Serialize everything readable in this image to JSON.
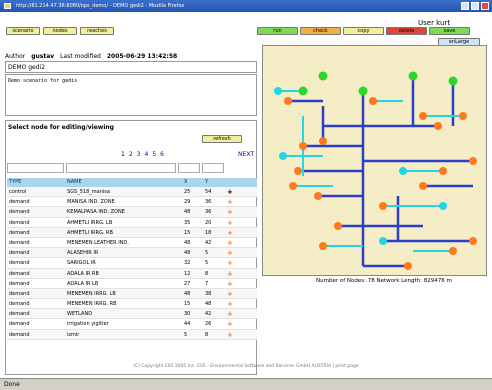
{
  "window": {
    "title": "http://81.214.47.36:8080/ops_demo/ - DEMO gedi2 - Mozilla Firefox"
  },
  "status_bar": {
    "text": "Done"
  },
  "toolbar": {
    "left_buttons": [
      "scenario",
      "nodes",
      "reaches"
    ],
    "right_buttons": [
      {
        "label": "run",
        "color": "#7ed957"
      },
      {
        "label": "check",
        "color": "#f3b04a"
      },
      {
        "label": "copy",
        "color": "#f2ef9a"
      },
      {
        "label": "delete",
        "color": "#e0453a"
      },
      {
        "label": "save",
        "color": "#7ed957"
      }
    ],
    "enlarge_label": "enLarge"
  },
  "user": {
    "label": "User kurt"
  },
  "scenario": {
    "author_label": "Author",
    "author": "gustav",
    "modified_label": "Last modified",
    "modified": "2005-06-29 13:42:58",
    "name": "DEMO gedi2",
    "description": "Demo scenario for gedis"
  },
  "node_panel": {
    "title": "Select node for editing/viewing",
    "refresh_label": "refresh",
    "pages": [
      "1",
      "2",
      "3",
      "4",
      "5",
      "6"
    ],
    "next_label": "NEXT",
    "columns": [
      "TYPE",
      "NAME",
      "X",
      "Y"
    ],
    "rows": [
      {
        "type": "control",
        "name": "SGS_518_manisa",
        "x": "25",
        "y": "54",
        "action": "+"
      },
      {
        "type": "demand",
        "name": "MANISA IND. ZONE",
        "x": "29",
        "y": "36",
        "action": "+"
      },
      {
        "type": "demand",
        "name": "KEMALPASA IND. ZONE",
        "x": "48",
        "y": "36",
        "action": "+"
      },
      {
        "type": "demand",
        "name": "AHMETLI IRRG. LB",
        "x": "35",
        "y": "20",
        "action": "+"
      },
      {
        "type": "demand",
        "name": "AHMETLI IRRG. RB",
        "x": "15",
        "y": "18",
        "action": "+"
      },
      {
        "type": "demand",
        "name": "MENEMEN LEATHER IND.",
        "x": "48",
        "y": "42",
        "action": "+"
      },
      {
        "type": "demand",
        "name": "ALASEHIR IR",
        "x": "48",
        "y": "5",
        "action": "+"
      },
      {
        "type": "demand",
        "name": "SARIGOL IR",
        "x": "32",
        "y": "5",
        "action": "+"
      },
      {
        "type": "demand",
        "name": "ADALA IR RB",
        "x": "12",
        "y": "8",
        "action": "+"
      },
      {
        "type": "demand",
        "name": "ADALA IR LB",
        "x": "27",
        "y": "7",
        "action": "+"
      },
      {
        "type": "demand",
        "name": "MENEMEN IRRG. LB",
        "x": "48",
        "y": "38",
        "action": "+"
      },
      {
        "type": "demand",
        "name": "MENEMEN IRRG. RB",
        "x": "15",
        "y": "48",
        "action": "+"
      },
      {
        "type": "demand",
        "name": "WETLAND",
        "x": "30",
        "y": "42",
        "action": "+"
      },
      {
        "type": "demand",
        "name": "irrigation yigitler",
        "x": "44",
        "y": "26",
        "action": "+"
      },
      {
        "type": "demand",
        "name": "izmir",
        "x": "5",
        "y": "8",
        "action": "+"
      }
    ]
  },
  "map": {
    "node_info": "Number of Nodes: 78 Network Length: 829476 m",
    "colors": {
      "background": "#f4edc6",
      "main": "#2b3fc9",
      "branch": "#22d6e8",
      "demand": "#ff7a1c",
      "supply": "#2dd62d"
    }
  },
  "footer": {
    "text": "(C) Copyright ESS 2005 Inc. ESS - Environmental Software and Services GmbH AUSTRIA | print page"
  }
}
